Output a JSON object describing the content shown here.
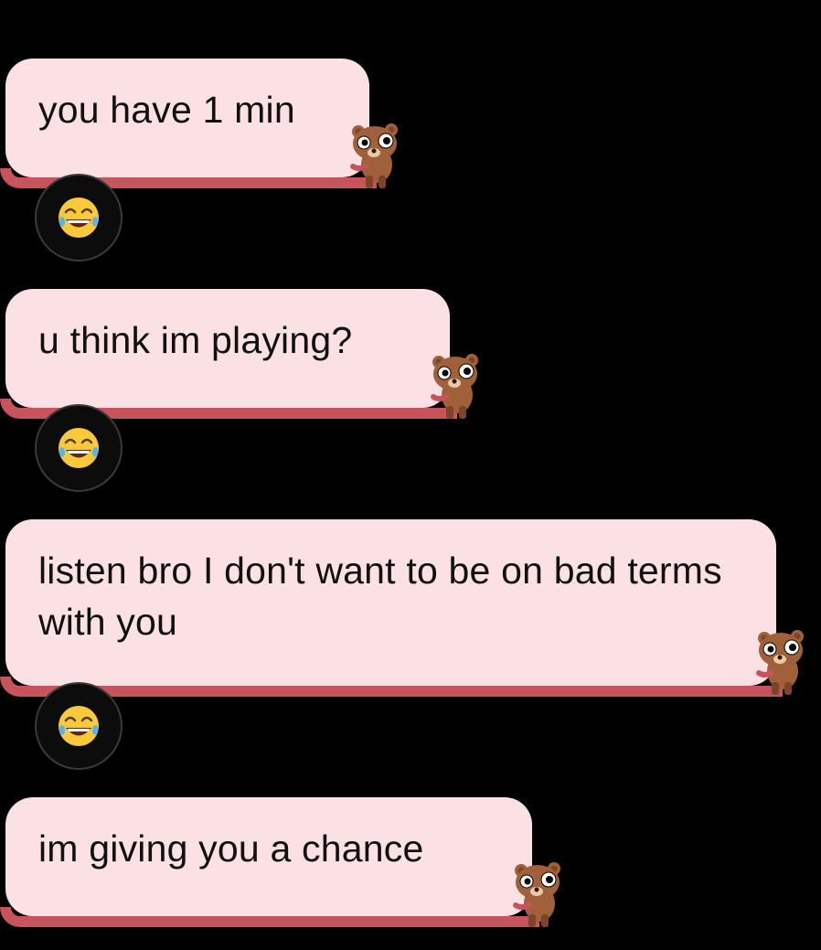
{
  "messages": [
    {
      "text": "you have 1 min",
      "reaction": "face-with-tears-of-joy"
    },
    {
      "text": "u think im playing?",
      "reaction": "face-with-tears-of-joy"
    },
    {
      "text": "listen bro I don't want to be on bad terms with you",
      "reaction": "face-with-tears-of-joy"
    },
    {
      "text": "im giving you a chance",
      "reaction": null
    }
  ],
  "colors": {
    "background": "#000000",
    "bubble": "#fbe1e3",
    "bubble_accent": "#c8545b",
    "bear_brown": "#a0613a"
  },
  "icons": {
    "sticker": "bear-sticker-icon",
    "reaction": "laughing-emoji-icon"
  }
}
